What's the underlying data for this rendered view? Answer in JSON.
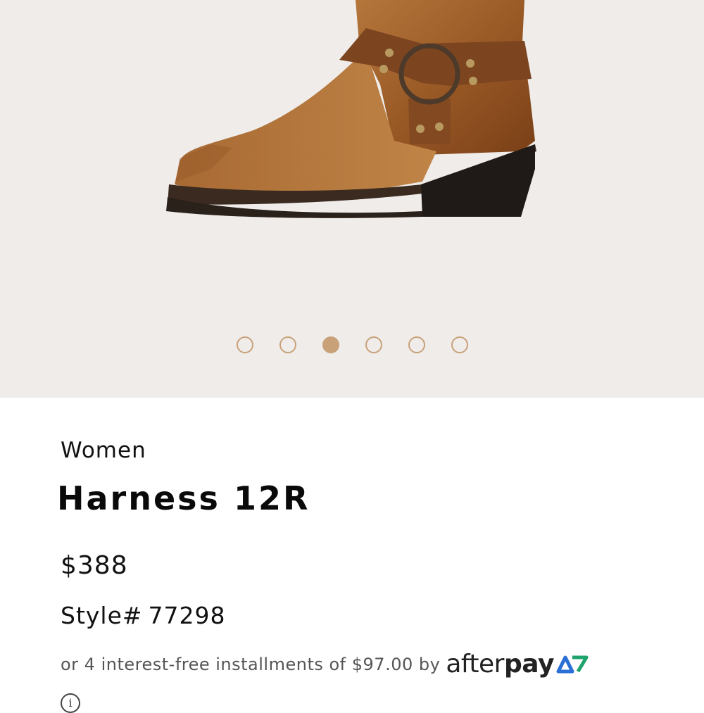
{
  "gallery": {
    "image_name": "boot-image",
    "dots": [
      {
        "active": false
      },
      {
        "active": false
      },
      {
        "active": true
      },
      {
        "active": false
      },
      {
        "active": false
      },
      {
        "active": false
      }
    ],
    "accent_color": "#c9a179",
    "background_color": "#efecea"
  },
  "product": {
    "category": "Women",
    "title": "Harness 12R",
    "price": "$388",
    "style_label": "Style#",
    "style_number": "77298"
  },
  "afterpay": {
    "text": "or 4 interest-free installments of $97.00 by",
    "logo_after": "after",
    "logo_pay": "pay",
    "mark_color": "#2a6fd6"
  },
  "info_icon": "info-icon"
}
